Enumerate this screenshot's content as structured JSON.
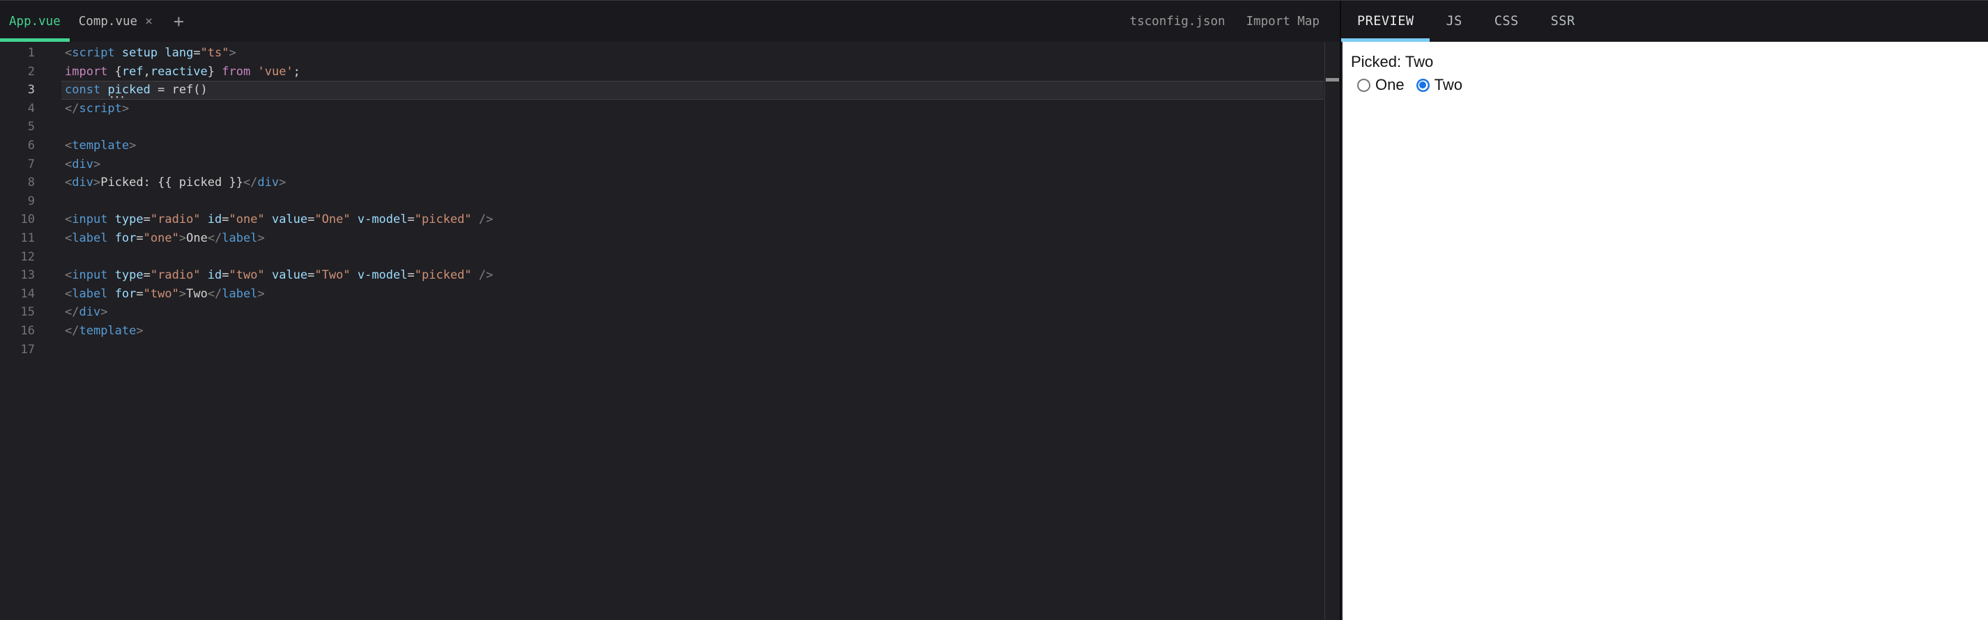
{
  "colors": {
    "branding_green": "#42d392",
    "preview_tab_underline": "#7accf3",
    "editor_background": "#201f23",
    "tabbar_background": "#1a191d",
    "radio_checked_blue": "#1a73e8"
  },
  "icons": {
    "close": "×",
    "add": "+"
  },
  "editor": {
    "file_tabs": [
      {
        "label": "App.vue",
        "active": true
      },
      {
        "label": "Comp.vue",
        "active": false,
        "closable": true
      }
    ],
    "config_tabs": [
      "tsconfig.json",
      "Import Map"
    ],
    "active_line": 3,
    "lines": [
      [
        [
          "p",
          "<"
        ],
        [
          "tag",
          "script"
        ],
        [
          "txt",
          " "
        ],
        [
          "attr",
          "setup"
        ],
        [
          "txt",
          " "
        ],
        [
          "attr",
          "lang"
        ],
        [
          "op",
          "="
        ],
        [
          "str",
          "\"ts\""
        ],
        [
          "p",
          ">"
        ]
      ],
      [
        [
          "kw",
          "import"
        ],
        [
          "txt",
          " "
        ],
        [
          "op",
          "{"
        ],
        [
          "var",
          "ref"
        ],
        [
          "op",
          ","
        ],
        [
          "var",
          "reactive"
        ],
        [
          "op",
          "}"
        ],
        [
          "txt",
          " "
        ],
        [
          "kw",
          "from"
        ],
        [
          "txt",
          " "
        ],
        [
          "str",
          "'vue'"
        ],
        [
          "op",
          ";"
        ]
      ],
      [
        [
          "kw2",
          "const"
        ],
        [
          "txt",
          " "
        ],
        [
          "hint",
          "picked"
        ],
        [
          "op",
          " = "
        ],
        [
          "txt",
          "ref"
        ],
        [
          "op",
          "()"
        ]
      ],
      [
        [
          "p",
          "</"
        ],
        [
          "tag",
          "script"
        ],
        [
          "p",
          ">"
        ]
      ],
      [],
      [
        [
          "p",
          "<"
        ],
        [
          "tag",
          "template"
        ],
        [
          "p",
          ">"
        ]
      ],
      [
        [
          "p",
          "<"
        ],
        [
          "tag",
          "div"
        ],
        [
          "p",
          ">"
        ]
      ],
      [
        [
          "p",
          "<"
        ],
        [
          "tag",
          "div"
        ],
        [
          "p",
          ">"
        ],
        [
          "txt",
          "Picked: {{ picked }}"
        ],
        [
          "p",
          "</"
        ],
        [
          "tag",
          "div"
        ],
        [
          "p",
          ">"
        ]
      ],
      [],
      [
        [
          "p",
          "<"
        ],
        [
          "tag",
          "input"
        ],
        [
          "txt",
          " "
        ],
        [
          "attr",
          "type"
        ],
        [
          "op",
          "="
        ],
        [
          "str",
          "\"radio\""
        ],
        [
          "txt",
          " "
        ],
        [
          "attr",
          "id"
        ],
        [
          "op",
          "="
        ],
        [
          "str",
          "\"one\""
        ],
        [
          "txt",
          " "
        ],
        [
          "attr",
          "value"
        ],
        [
          "op",
          "="
        ],
        [
          "str",
          "\"One\""
        ],
        [
          "txt",
          " "
        ],
        [
          "attr",
          "v-model"
        ],
        [
          "op",
          "="
        ],
        [
          "str",
          "\"picked\""
        ],
        [
          "txt",
          " "
        ],
        [
          "p",
          "/>"
        ]
      ],
      [
        [
          "p",
          "<"
        ],
        [
          "tag",
          "label"
        ],
        [
          "txt",
          " "
        ],
        [
          "attr",
          "for"
        ],
        [
          "op",
          "="
        ],
        [
          "str",
          "\"one\""
        ],
        [
          "p",
          ">"
        ],
        [
          "txt",
          "One"
        ],
        [
          "p",
          "</"
        ],
        [
          "tag",
          "label"
        ],
        [
          "p",
          ">"
        ]
      ],
      [],
      [
        [
          "p",
          "<"
        ],
        [
          "tag",
          "input"
        ],
        [
          "txt",
          " "
        ],
        [
          "attr",
          "type"
        ],
        [
          "op",
          "="
        ],
        [
          "str",
          "\"radio\""
        ],
        [
          "txt",
          " "
        ],
        [
          "attr",
          "id"
        ],
        [
          "op",
          "="
        ],
        [
          "str",
          "\"two\""
        ],
        [
          "txt",
          " "
        ],
        [
          "attr",
          "value"
        ],
        [
          "op",
          "="
        ],
        [
          "str",
          "\"Two\""
        ],
        [
          "txt",
          " "
        ],
        [
          "attr",
          "v-model"
        ],
        [
          "op",
          "="
        ],
        [
          "str",
          "\"picked\""
        ],
        [
          "txt",
          " "
        ],
        [
          "p",
          "/>"
        ]
      ],
      [
        [
          "p",
          "<"
        ],
        [
          "tag",
          "label"
        ],
        [
          "txt",
          " "
        ],
        [
          "attr",
          "for"
        ],
        [
          "op",
          "="
        ],
        [
          "str",
          "\"two\""
        ],
        [
          "p",
          ">"
        ],
        [
          "txt",
          "Two"
        ],
        [
          "p",
          "</"
        ],
        [
          "tag",
          "label"
        ],
        [
          "p",
          ">"
        ]
      ],
      [
        [
          "p",
          "</"
        ],
        [
          "tag",
          "div"
        ],
        [
          "p",
          ">"
        ]
      ],
      [
        [
          "p",
          "</"
        ],
        [
          "tag",
          "template"
        ],
        [
          "p",
          ">"
        ]
      ],
      []
    ]
  },
  "output": {
    "tabs": [
      {
        "label": "PREVIEW",
        "active": true
      },
      {
        "label": "JS",
        "active": false
      },
      {
        "label": "CSS",
        "active": false
      },
      {
        "label": "SSR",
        "active": false
      }
    ]
  },
  "preview": {
    "picked_text": "Picked: Two",
    "options": [
      {
        "label": "One",
        "checked": false
      },
      {
        "label": "Two",
        "checked": true
      }
    ]
  }
}
